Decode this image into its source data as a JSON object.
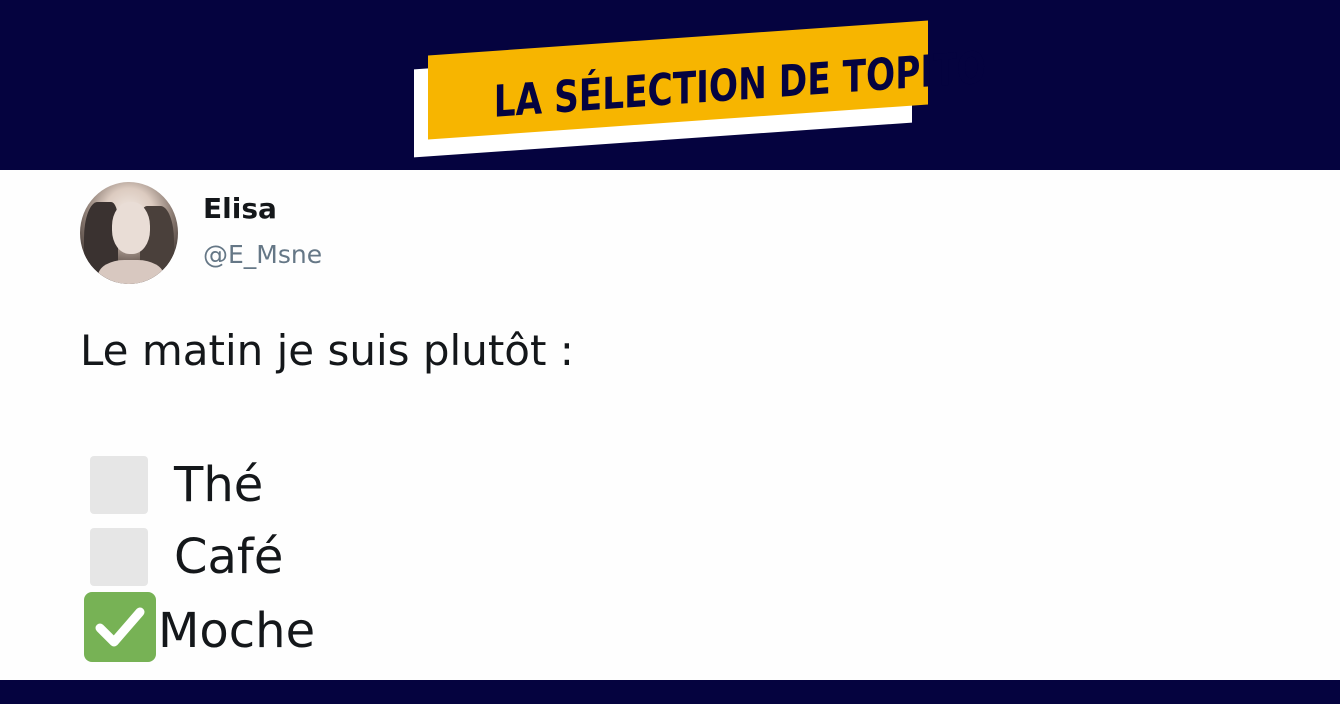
{
  "header": {
    "badge_text": "LA SÉLECTION DE TOPITO",
    "colors": {
      "background": "#05033f",
      "badge": "#f7b500"
    }
  },
  "tweet": {
    "author_name": "Elisa",
    "author_handle": "@E_Msne",
    "text": "Le matin je suis plutôt :",
    "options": [
      {
        "label": "Thé",
        "checked": false
      },
      {
        "label": "Café",
        "checked": false
      },
      {
        "label": "Moche",
        "checked": true
      }
    ],
    "colors": {
      "check_green": "#77b255"
    }
  }
}
